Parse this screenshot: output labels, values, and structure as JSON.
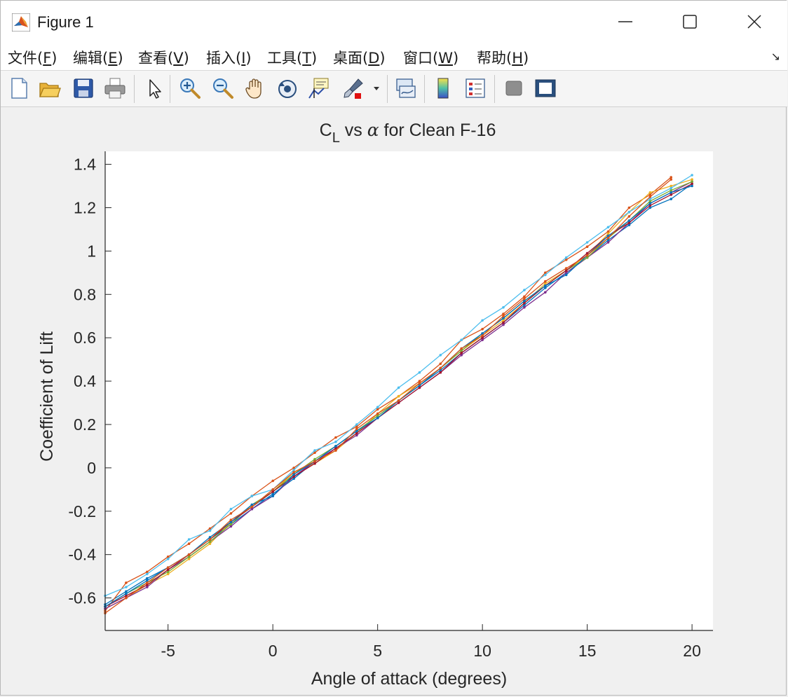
{
  "window": {
    "title": "Figure 1"
  },
  "menu": [
    {
      "pre": "文件(",
      "mn": "F",
      "post": ")"
    },
    {
      "pre": "编辑(",
      "mn": "E",
      "post": ")"
    },
    {
      "pre": "查看(",
      "mn": "V",
      "post": ")"
    },
    {
      "pre": "插入(",
      "mn": "I",
      "post": ")"
    },
    {
      "pre": "工具(",
      "mn": "T",
      "post": ")"
    },
    {
      "pre": "桌面(",
      "mn": "D",
      "post": ")"
    },
    {
      "pre": "窗口(",
      "mn": "W",
      "post": ")"
    },
    {
      "pre": "帮助(",
      "mn": "H",
      "post": ")"
    }
  ],
  "toolbar": {
    "icons": [
      "new-figure-icon",
      "open-file-icon",
      "save-icon",
      "print-icon",
      "pointer-icon",
      "zoom-in-icon",
      "zoom-out-icon",
      "pan-hand-icon",
      "rotate-3d-icon",
      "data-cursor-icon",
      "brush-icon",
      "link-plot-icon",
      "colorbar-icon",
      "legend-icon",
      "hide-plot-tools-icon",
      "show-plot-tools-icon"
    ]
  },
  "chart_data": {
    "type": "line",
    "title": "C_L vs α for Clean F-16",
    "title_parts": {
      "main": "C",
      "sub": "L",
      "mid": " vs ",
      "greek": "α",
      "rest": " for Clean F-16"
    },
    "xlabel": "Angle of attack (degrees)",
    "ylabel": "Coefficient of Lift",
    "xlim": [
      -8,
      21
    ],
    "ylim": [
      -0.75,
      1.46
    ],
    "xticks": [
      -5,
      0,
      5,
      10,
      15,
      20
    ],
    "yticks": [
      -0.6,
      -0.4,
      -0.2,
      0,
      0.2,
      0.4,
      0.6,
      0.8,
      1,
      1.2,
      1.4
    ],
    "ytick_labels": [
      "-0.6",
      "-0.4",
      "-0.2",
      "0",
      "0.2",
      "0.4",
      "0.6",
      "0.8",
      "1",
      "1.2",
      "1.4"
    ],
    "grid": false,
    "marker": "point",
    "series": [
      {
        "color": "#0072BD",
        "x": [
          -8,
          -7,
          -6,
          -5,
          -4,
          -3,
          -2,
          -1,
          0,
          1,
          2,
          3,
          4,
          5,
          6,
          7,
          8,
          9,
          10,
          11,
          12,
          13,
          14,
          15,
          16,
          17,
          18,
          19,
          20
        ],
        "y": [
          -0.63,
          -0.57,
          -0.51,
          -0.46,
          -0.4,
          -0.33,
          -0.26,
          -0.19,
          -0.12,
          -0.05,
          0.03,
          0.1,
          0.17,
          0.24,
          0.31,
          0.38,
          0.45,
          0.53,
          0.6,
          0.67,
          0.75,
          0.83,
          0.9,
          0.97,
          1.05,
          1.12,
          1.2,
          1.24,
          1.31
        ]
      },
      {
        "color": "#D95319",
        "x": [
          -8,
          -7,
          -6,
          -5,
          -4,
          -3,
          -2,
          -1,
          0,
          1,
          2,
          3,
          4,
          5,
          6,
          7,
          8,
          9,
          10,
          11,
          12,
          13,
          14,
          15,
          16,
          17,
          18,
          19
        ],
        "y": [
          -0.66,
          -0.53,
          -0.48,
          -0.41,
          -0.35,
          -0.28,
          -0.21,
          -0.13,
          -0.06,
          0.0,
          0.07,
          0.14,
          0.19,
          0.27,
          0.33,
          0.4,
          0.48,
          0.59,
          0.64,
          0.71,
          0.79,
          0.9,
          0.96,
          1.02,
          1.09,
          1.2,
          1.26,
          1.34
        ]
      },
      {
        "color": "#EDB120",
        "x": [
          -8,
          -7,
          -6,
          -5,
          -4,
          -3,
          -2,
          -1,
          0,
          1,
          2,
          3,
          4,
          5,
          6,
          7,
          8,
          9,
          10,
          11,
          12,
          13,
          14,
          15,
          16,
          17,
          18,
          19,
          20
        ],
        "y": [
          -0.65,
          -0.6,
          -0.54,
          -0.49,
          -0.42,
          -0.35,
          -0.25,
          -0.18,
          -0.11,
          -0.02,
          0.02,
          0.08,
          0.16,
          0.25,
          0.33,
          0.39,
          0.46,
          0.54,
          0.61,
          0.68,
          0.76,
          0.85,
          0.91,
          0.98,
          1.08,
          1.18,
          1.27,
          1.3,
          1.33
        ]
      },
      {
        "color": "#7E2F8E",
        "x": [
          -8,
          -7,
          -6,
          -5,
          -4,
          -3,
          -2,
          -1,
          0,
          1,
          2,
          3,
          4,
          5,
          6,
          7,
          8,
          9,
          10,
          11,
          12,
          13,
          14,
          15,
          16,
          17,
          18,
          19,
          20
        ],
        "y": [
          -0.65,
          -0.6,
          -0.55,
          -0.47,
          -0.41,
          -0.34,
          -0.27,
          -0.19,
          -0.13,
          -0.04,
          0.03,
          0.09,
          0.15,
          0.23,
          0.3,
          0.37,
          0.44,
          0.52,
          0.59,
          0.66,
          0.74,
          0.81,
          0.9,
          0.97,
          1.04,
          1.13,
          1.22,
          1.27,
          1.32
        ]
      },
      {
        "color": "#77AC30",
        "x": [
          -8,
          -7,
          -6,
          -5,
          -4,
          -3,
          -2,
          -1,
          0,
          1,
          2,
          3,
          4,
          5,
          6,
          7,
          8,
          9,
          10,
          11,
          12,
          13,
          14,
          15,
          16,
          17,
          18,
          19,
          20
        ],
        "y": [
          -0.64,
          -0.58,
          -0.53,
          -0.48,
          -0.41,
          -0.34,
          -0.26,
          -0.17,
          -0.11,
          -0.03,
          0.04,
          0.1,
          0.17,
          0.24,
          0.31,
          0.38,
          0.46,
          0.54,
          0.62,
          0.69,
          0.77,
          0.84,
          0.91,
          0.97,
          1.06,
          1.14,
          1.23,
          1.28,
          1.32
        ]
      },
      {
        "color": "#4DBEEE",
        "x": [
          -8,
          -7,
          -6,
          -5,
          -4,
          -3,
          -2,
          -1,
          0,
          1,
          2,
          3,
          4,
          5,
          6,
          7,
          8,
          9,
          10,
          11,
          12,
          13,
          14,
          15,
          16,
          17,
          18,
          19,
          20
        ],
        "y": [
          -0.59,
          -0.55,
          -0.49,
          -0.42,
          -0.33,
          -0.29,
          -0.19,
          -0.13,
          -0.1,
          -0.01,
          0.08,
          0.12,
          0.2,
          0.28,
          0.37,
          0.44,
          0.52,
          0.59,
          0.68,
          0.74,
          0.82,
          0.89,
          0.97,
          1.04,
          1.11,
          1.18,
          1.24,
          1.29,
          1.35
        ]
      },
      {
        "color": "#A2142F",
        "x": [
          -8,
          -7,
          -6,
          -5,
          -4,
          -3,
          -2,
          -1,
          0,
          1,
          2,
          3,
          4,
          5,
          6,
          7,
          8,
          9,
          10,
          11,
          12,
          13,
          14,
          15,
          16,
          17,
          18,
          19,
          20
        ],
        "y": [
          -0.64,
          -0.59,
          -0.54,
          -0.47,
          -0.4,
          -0.33,
          -0.25,
          -0.18,
          -0.11,
          -0.04,
          0.02,
          0.09,
          0.16,
          0.23,
          0.3,
          0.37,
          0.44,
          0.53,
          0.6,
          0.67,
          0.76,
          0.84,
          0.91,
          0.99,
          1.07,
          1.13,
          1.21,
          1.26,
          1.31
        ]
      },
      {
        "color": "#0072BD",
        "x": [
          -8,
          -7,
          -6,
          -5,
          -4,
          -3,
          -2,
          -1,
          0,
          1,
          2,
          3,
          4,
          5,
          6,
          7,
          8,
          9,
          10,
          11,
          12,
          13,
          14,
          15,
          16,
          17,
          18,
          19,
          20
        ],
        "y": [
          -0.64,
          -0.58,
          -0.52,
          -0.46,
          -0.4,
          -0.32,
          -0.25,
          -0.17,
          -0.13,
          -0.03,
          0.03,
          0.1,
          0.17,
          0.23,
          0.31,
          0.38,
          0.46,
          0.55,
          0.62,
          0.69,
          0.77,
          0.84,
          0.89,
          0.98,
          1.07,
          1.14,
          1.22,
          1.27,
          1.3
        ]
      },
      {
        "color": "#D95319",
        "x": [
          -8,
          -7,
          -6,
          -5,
          -4,
          -3,
          -2,
          -1,
          0,
          1,
          2,
          3,
          4,
          5,
          6,
          7,
          8,
          9,
          10,
          11,
          12,
          13,
          14,
          15,
          16,
          17,
          18,
          19
        ],
        "y": [
          -0.67,
          -0.6,
          -0.53,
          -0.46,
          -0.4,
          -0.33,
          -0.24,
          -0.18,
          -0.1,
          -0.02,
          0.03,
          0.08,
          0.18,
          0.25,
          0.31,
          0.39,
          0.46,
          0.55,
          0.61,
          0.7,
          0.78,
          0.86,
          0.92,
          0.98,
          1.06,
          1.16,
          1.25,
          1.33
        ]
      }
    ]
  }
}
